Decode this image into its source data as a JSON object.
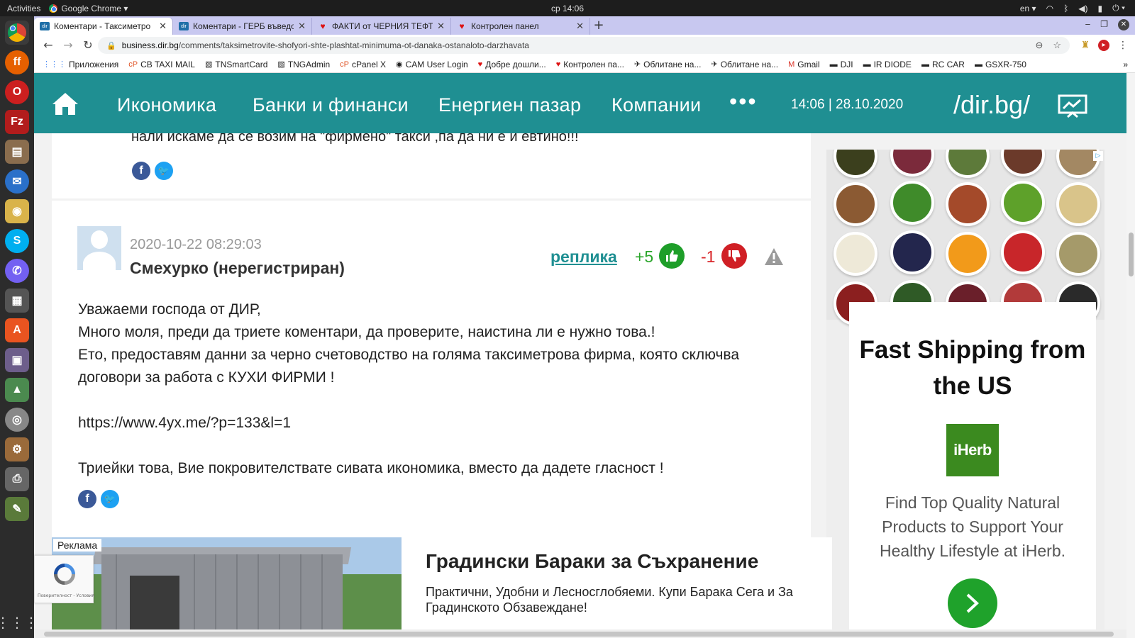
{
  "os_bar": {
    "activities": "Activities",
    "app_name": "Google Chrome ▾",
    "clock": "ср 14:06",
    "lang": "en ▾"
  },
  "tabs": [
    {
      "label": "Коментари - Таксиметро",
      "favicon": "dir"
    },
    {
      "label": "Коментари - ГЕРБ въведо",
      "favicon": "dir"
    },
    {
      "label": "ФАКТИ от ЧЕРНИЯ ТЕФТ",
      "favicon": "heart"
    },
    {
      "label": "Контролен панел",
      "favicon": "heart"
    }
  ],
  "address_bar": {
    "host": "business.dir.bg",
    "path": "/comments/taksimetrovite-shofyori-shte-plashtat-minimuma-ot-danaka-ostanaloto-darzhavata"
  },
  "bookmarks": [
    {
      "label": "Приложения",
      "icon": "apps-icon"
    },
    {
      "label": "CB TAXI MAIL",
      "icon": "cpanel-icon"
    },
    {
      "label": "TNSmartCard",
      "icon": "card-icon"
    },
    {
      "label": "TNGAdmin",
      "icon": "card-icon"
    },
    {
      "label": "cPanel X",
      "icon": "cpanel-icon"
    },
    {
      "label": "CAM User Login",
      "icon": "cam-icon"
    },
    {
      "label": "Добре дошли...",
      "icon": "heart-icon"
    },
    {
      "label": "Контролен па...",
      "icon": "heart-icon"
    },
    {
      "label": "Облитане на...",
      "icon": "drone-icon"
    },
    {
      "label": "Облитане на...",
      "icon": "drone-icon"
    },
    {
      "label": "Gmail",
      "icon": "gmail-icon"
    },
    {
      "label": "DJI",
      "icon": "folder-icon"
    },
    {
      "label": "IR DIODE",
      "icon": "folder-icon"
    },
    {
      "label": "RC CAR",
      "icon": "folder-icon"
    },
    {
      "label": "GSXR-750",
      "icon": "folder-icon"
    }
  ],
  "site_header": {
    "menu": [
      "Икономика",
      "Банки и финанси",
      "Енергиен пазар",
      "Компании"
    ],
    "more": "•••",
    "datetime": "14:06 | 28.10.2020",
    "logo": "/dir.bg/",
    "accent": "#1f8f92"
  },
  "prev_comment": {
    "text": "нали искаме да се возим на \"фирмено\" такси ,па да ни е и евтино!!!"
  },
  "comment": {
    "date": "2020-10-22 08:29:03",
    "author": "Смехурко (нерегистриран)",
    "reply_label": "реплика",
    "likes": "+5",
    "dislikes": "-1",
    "body": [
      "Уважаеми господа от ДИР,",
      "Много моля, преди да триете коментари, да проверите, наистина ли е нужно това.!",
      "Ето, предоставям данни за черно счетоводство на голяма таксиметрова фирма, която сключва договори за работа с КУХИ ФИРМИ !",
      "",
      "https://www.4yx.me/?p=133&l=1",
      "",
      "Триейки това, Вие покровителствате сивата икономика, вместо да дадете гласност !"
    ]
  },
  "bottom_ad": {
    "badge": "Реклама",
    "title": "Градински Бараки за Съхранение",
    "description": "Практични, Удобни и Лесносглобяеми. Купи Барака Сега и За Градинското Обзавеждане!"
  },
  "recaptcha": {
    "text": "Поверителност - Условия"
  },
  "side_ad": {
    "headline": "Fast Shipping from the US",
    "brand": "iHerb",
    "body": "Find Top Quality Natural Products to Support Your Healthy Lifestyle at iHerb.",
    "colors": {
      "brand": "#3b8a1f",
      "button": "#1fa22b"
    }
  }
}
